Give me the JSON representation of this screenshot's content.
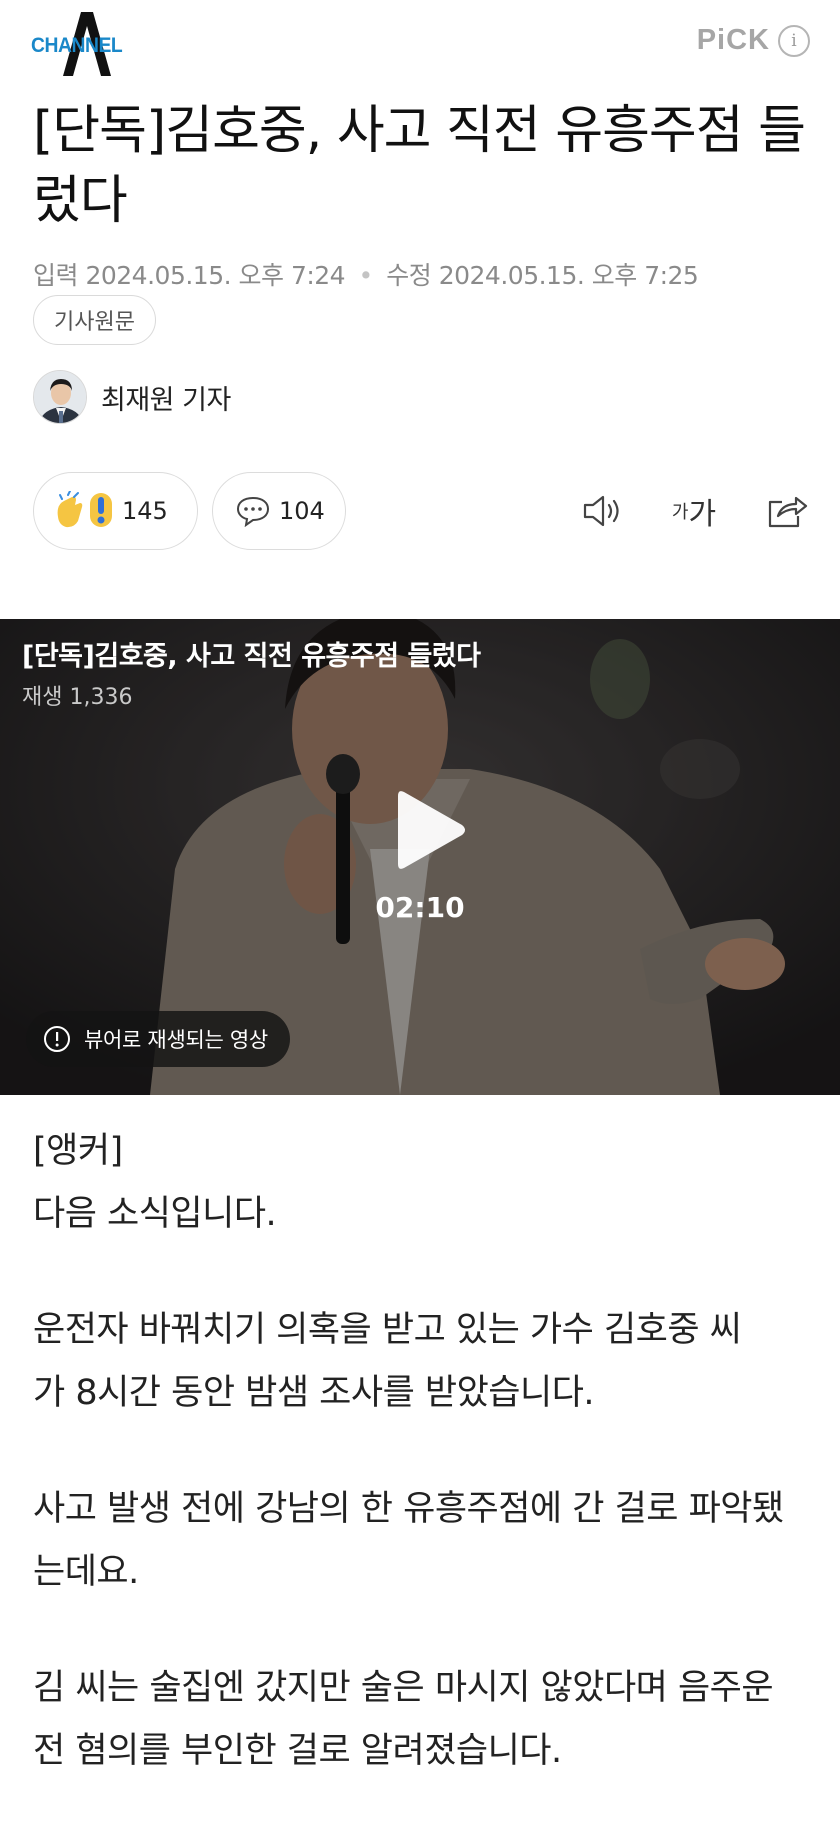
{
  "header": {
    "logo_text": "CHANNEL",
    "pick_label": "PiCK",
    "info_label": "i"
  },
  "article": {
    "title": "[단독]김호중, 사고 직전 유흥주점 들렀다",
    "input_label": "입력",
    "input_time": "2024.05.15. 오후 7:24",
    "edit_label": "수정",
    "edit_time": "2024.05.15. 오후 7:25",
    "original_button": "기사원문",
    "reporter": "최재원 기자"
  },
  "actions": {
    "reaction_count": "145",
    "comment_count": "104",
    "font_small": "가",
    "font_big": "가"
  },
  "video": {
    "title": "[단독]김호중, 사고 직전 유흥주점 들렀다",
    "views": "재생 1,336",
    "duration": "02:10",
    "notice": "뷰어로 재생되는 영상"
  },
  "body": {
    "p1": "[앵커]",
    "p2": "다음 소식입니다.",
    "p3_l1": "운전자 바꿔치기 의혹을 받고 있는 가수 김호중 씨",
    "p3_l2": "가 8시간 동안 밤샘 조사를 받았습니다.",
    "p4_l1": "사고 발생 전에 강남의 한 유흥주점에 간 걸로 파악됐",
    "p4_l2": "는데요.",
    "p5_l1": "김 씨는 술집엔 갔지만 술은 마시지 않았다며 음주운",
    "p5_l2": "전 혐의를 부인한 걸로 알려졌습니다."
  },
  "colors": {
    "brand_blue": "#1a88c9",
    "meta_gray": "#8a8a8a"
  },
  "icons": [
    "a-logo-icon",
    "info-icon",
    "clap-emoji-icon",
    "exclamation-emoji-icon",
    "comment-icon",
    "speaker-icon",
    "font-size-icon",
    "share-icon",
    "play-icon",
    "alert-circle-icon"
  ]
}
